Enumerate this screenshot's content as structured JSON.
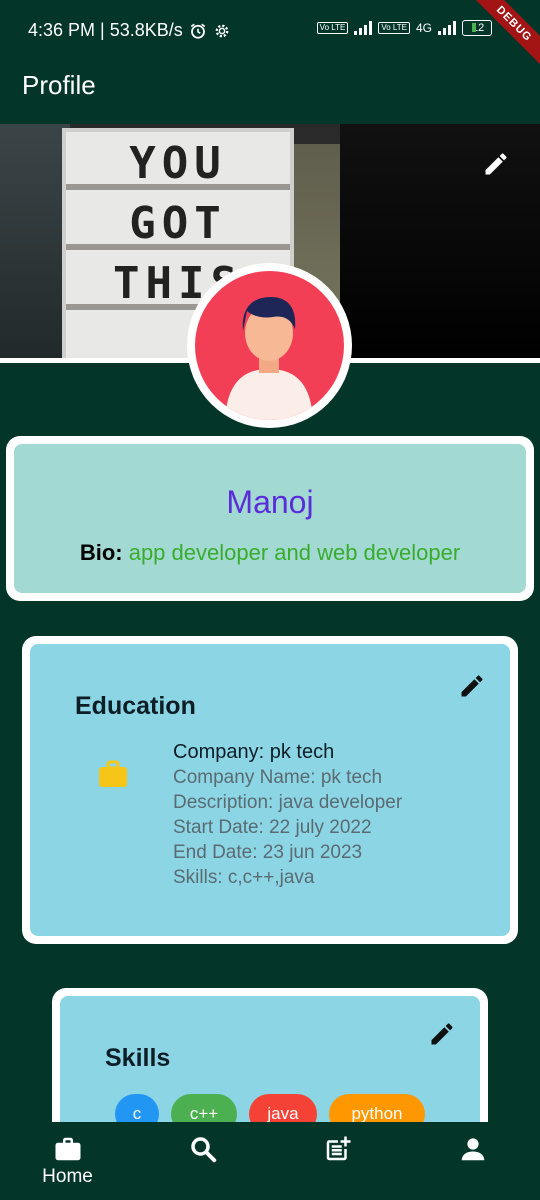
{
  "status_bar": {
    "time_speed": "4:36 PM | 53.8KB/s",
    "alarm_icon": "alarm-icon",
    "settings_icon": "gear-icon",
    "volte1": "Vo LTE",
    "volte2": "Vo LTE",
    "network": "4G",
    "battery": "12",
    "debug_banner": "DEBUG"
  },
  "app_bar": {
    "title": "Profile"
  },
  "cover": {
    "text_lines": [
      "YOU",
      "GOT",
      "THIS"
    ],
    "edit_icon": "pencil-icon"
  },
  "profile": {
    "name": "Manoj",
    "bio_label": "Bio:",
    "bio_value": "app developer and web developer"
  },
  "education": {
    "title": "Education",
    "edit_icon": "pencil-icon",
    "item_icon": "briefcase-icon",
    "company": "Company: pk tech",
    "company_name": "Company Name: pk tech",
    "description": "Description: java developer",
    "start_date": "Start Date: 22 july 2022",
    "end_date": "End Date: 23 jun 2023",
    "skills": "Skills: c,c++,java"
  },
  "skills": {
    "title": "Skills",
    "edit_icon": "pencil-icon",
    "chips": [
      {
        "label": "c",
        "color": "#2196f3"
      },
      {
        "label": "c++",
        "color": "#4caf50"
      },
      {
        "label": "java",
        "color": "#f44336"
      },
      {
        "label": "python",
        "color": "#ff9800"
      }
    ]
  },
  "bottom_nav": {
    "items": [
      {
        "icon": "briefcase-icon",
        "label": "Home"
      },
      {
        "icon": "search-icon",
        "label": ""
      },
      {
        "icon": "post-add-icon",
        "label": ""
      },
      {
        "icon": "person-icon",
        "label": ""
      }
    ]
  },
  "colors": {
    "background": "#033628",
    "name": "#5a2dd8",
    "bio_value": "#3aac2d",
    "profile_card": "#a2d9d3",
    "section_card": "#8bd5e5",
    "avatar_bg": "#f23f56"
  }
}
